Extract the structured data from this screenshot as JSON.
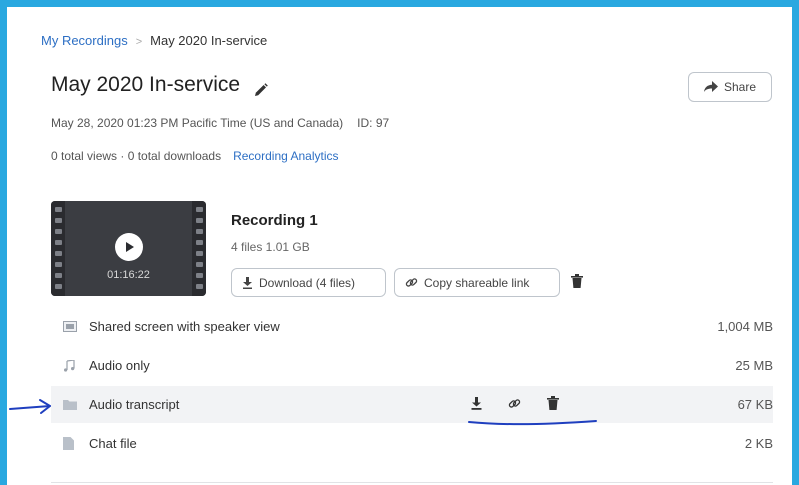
{
  "breadcrumb": {
    "root": "My Recordings",
    "current": "May 2020 In-service"
  },
  "title": "May 2020 In-service",
  "meta": {
    "datetime": "May 28, 2020 01:23 PM Pacific Time (US and Canada)",
    "id": "ID: 97",
    "stats": "0 total views · 0 total downloads",
    "analytics_link": "Recording Analytics"
  },
  "share_label": "Share",
  "recording": {
    "thumbnail_duration": "01:16:22",
    "title": "Recording 1",
    "summary": "4 files  1.01 GB",
    "download_label": "Download (4 files)",
    "copy_link_label": "Copy shareable link"
  },
  "files": [
    {
      "name": "Shared screen with speaker view",
      "size": "1,004 MB",
      "icon": "screen-icon"
    },
    {
      "name": "Audio only",
      "size": "25 MB",
      "icon": "music-note-icon"
    },
    {
      "name": "Audio transcript",
      "size": "67 KB",
      "icon": "folder-icon"
    },
    {
      "name": "Chat file",
      "size": "2 KB",
      "icon": "document-icon"
    }
  ],
  "colors": {
    "link": "#2d6fc4",
    "frame": "#29a8e0",
    "annotation": "#1f3fbf",
    "highlight_row": "#f2f3f5"
  }
}
